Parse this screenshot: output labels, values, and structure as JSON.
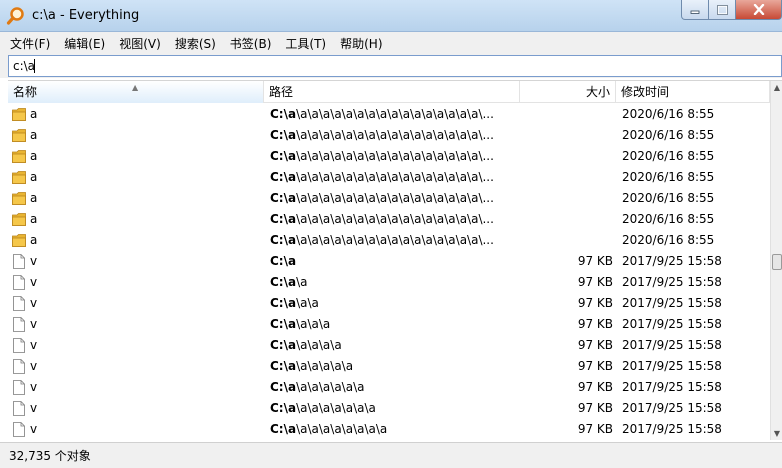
{
  "window": {
    "title": "c:\\a - Everything",
    "app_icon": "search-magnifier-icon"
  },
  "menu": [
    {
      "label": "文件(F)"
    },
    {
      "label": "编辑(E)"
    },
    {
      "label": "视图(V)"
    },
    {
      "label": "搜索(S)"
    },
    {
      "label": "书签(B)"
    },
    {
      "label": "工具(T)"
    },
    {
      "label": "帮助(H)"
    }
  ],
  "search": {
    "value": "c:\\a"
  },
  "columns": {
    "name": "名称",
    "path": "路径",
    "size": "大小",
    "modified": "修改时间"
  },
  "rows": [
    {
      "type": "folder",
      "name": "a",
      "path_bold": "C:\\a",
      "path_rest": "\\a\\a\\a\\a\\a\\a\\a\\a\\a\\a\\a\\a\\a\\a\\a\\a\\...",
      "size": "",
      "modified": "2020/6/16 8:55"
    },
    {
      "type": "folder",
      "name": "a",
      "path_bold": "C:\\a",
      "path_rest": "\\a\\a\\a\\a\\a\\a\\a\\a\\a\\a\\a\\a\\a\\a\\a\\a\\...",
      "size": "",
      "modified": "2020/6/16 8:55"
    },
    {
      "type": "folder",
      "name": "a",
      "path_bold": "C:\\a",
      "path_rest": "\\a\\a\\a\\a\\a\\a\\a\\a\\a\\a\\a\\a\\a\\a\\a\\a\\...",
      "size": "",
      "modified": "2020/6/16 8:55"
    },
    {
      "type": "folder",
      "name": "a",
      "path_bold": "C:\\a",
      "path_rest": "\\a\\a\\a\\a\\a\\a\\a\\a\\a\\a\\a\\a\\a\\a\\a\\a\\...",
      "size": "",
      "modified": "2020/6/16 8:55"
    },
    {
      "type": "folder",
      "name": "a",
      "path_bold": "C:\\a",
      "path_rest": "\\a\\a\\a\\a\\a\\a\\a\\a\\a\\a\\a\\a\\a\\a\\a\\a\\...",
      "size": "",
      "modified": "2020/6/16 8:55"
    },
    {
      "type": "folder",
      "name": "a",
      "path_bold": "C:\\a",
      "path_rest": "\\a\\a\\a\\a\\a\\a\\a\\a\\a\\a\\a\\a\\a\\a\\a\\a\\...",
      "size": "",
      "modified": "2020/6/16 8:55"
    },
    {
      "type": "folder",
      "name": "a",
      "path_bold": "C:\\a",
      "path_rest": "\\a\\a\\a\\a\\a\\a\\a\\a\\a\\a\\a\\a\\a\\a\\a\\a\\...",
      "size": "",
      "modified": "2020/6/16 8:55"
    },
    {
      "type": "file",
      "name": "v",
      "path_bold": "C:\\a",
      "path_rest": "",
      "size": "97 KB",
      "modified": "2017/9/25 15:58"
    },
    {
      "type": "file",
      "name": "v",
      "path_bold": "C:\\a",
      "path_rest": "\\a",
      "size": "97 KB",
      "modified": "2017/9/25 15:58"
    },
    {
      "type": "file",
      "name": "v",
      "path_bold": "C:\\a",
      "path_rest": "\\a\\a",
      "size": "97 KB",
      "modified": "2017/9/25 15:58"
    },
    {
      "type": "file",
      "name": "v",
      "path_bold": "C:\\a",
      "path_rest": "\\a\\a\\a",
      "size": "97 KB",
      "modified": "2017/9/25 15:58"
    },
    {
      "type": "file",
      "name": "v",
      "path_bold": "C:\\a",
      "path_rest": "\\a\\a\\a\\a",
      "size": "97 KB",
      "modified": "2017/9/25 15:58"
    },
    {
      "type": "file",
      "name": "v",
      "path_bold": "C:\\a",
      "path_rest": "\\a\\a\\a\\a\\a",
      "size": "97 KB",
      "modified": "2017/9/25 15:58"
    },
    {
      "type": "file",
      "name": "v",
      "path_bold": "C:\\a",
      "path_rest": "\\a\\a\\a\\a\\a\\a",
      "size": "97 KB",
      "modified": "2017/9/25 15:58"
    },
    {
      "type": "file",
      "name": "v",
      "path_bold": "C:\\a",
      "path_rest": "\\a\\a\\a\\a\\a\\a\\a",
      "size": "97 KB",
      "modified": "2017/9/25 15:58"
    },
    {
      "type": "file",
      "name": "v",
      "path_bold": "C:\\a",
      "path_rest": "\\a\\a\\a\\a\\a\\a\\a\\a",
      "size": "97 KB",
      "modified": "2017/9/25 15:58"
    }
  ],
  "status": {
    "text": "32,735 个对象"
  },
  "colors": {
    "titlebar": "#b9d1ea",
    "folder": "#e8b432",
    "close_button": "#c74a36"
  }
}
